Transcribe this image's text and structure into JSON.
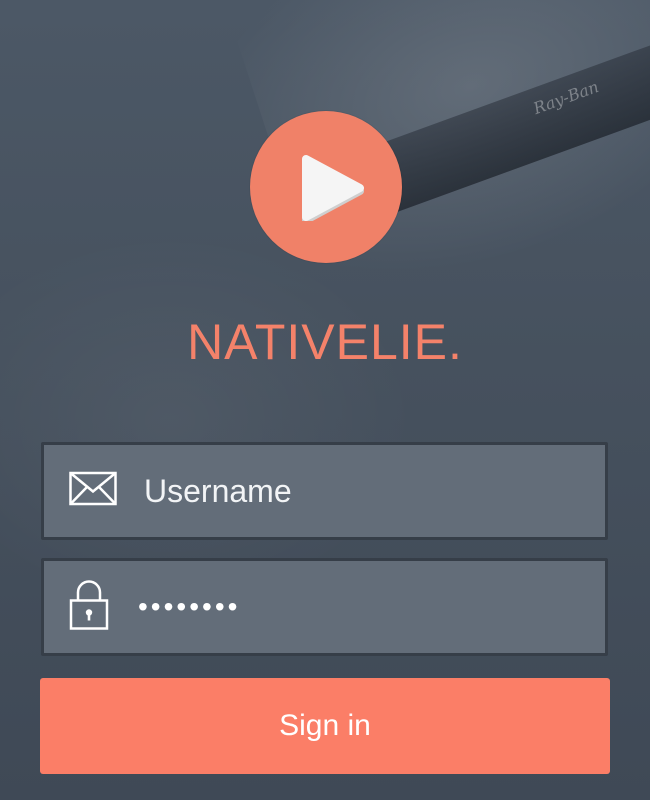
{
  "brand": {
    "name": "NATIVELIE.",
    "logo_icon": "play-icon",
    "accent_color": "#f08168"
  },
  "background": {
    "signature": "Ray-Ban"
  },
  "form": {
    "username": {
      "placeholder": "Username",
      "value": "",
      "icon": "envelope-icon"
    },
    "password": {
      "value": "********",
      "icon": "lock-icon"
    },
    "submit_label": "Sign in",
    "submit_color": "#fb7e67"
  }
}
